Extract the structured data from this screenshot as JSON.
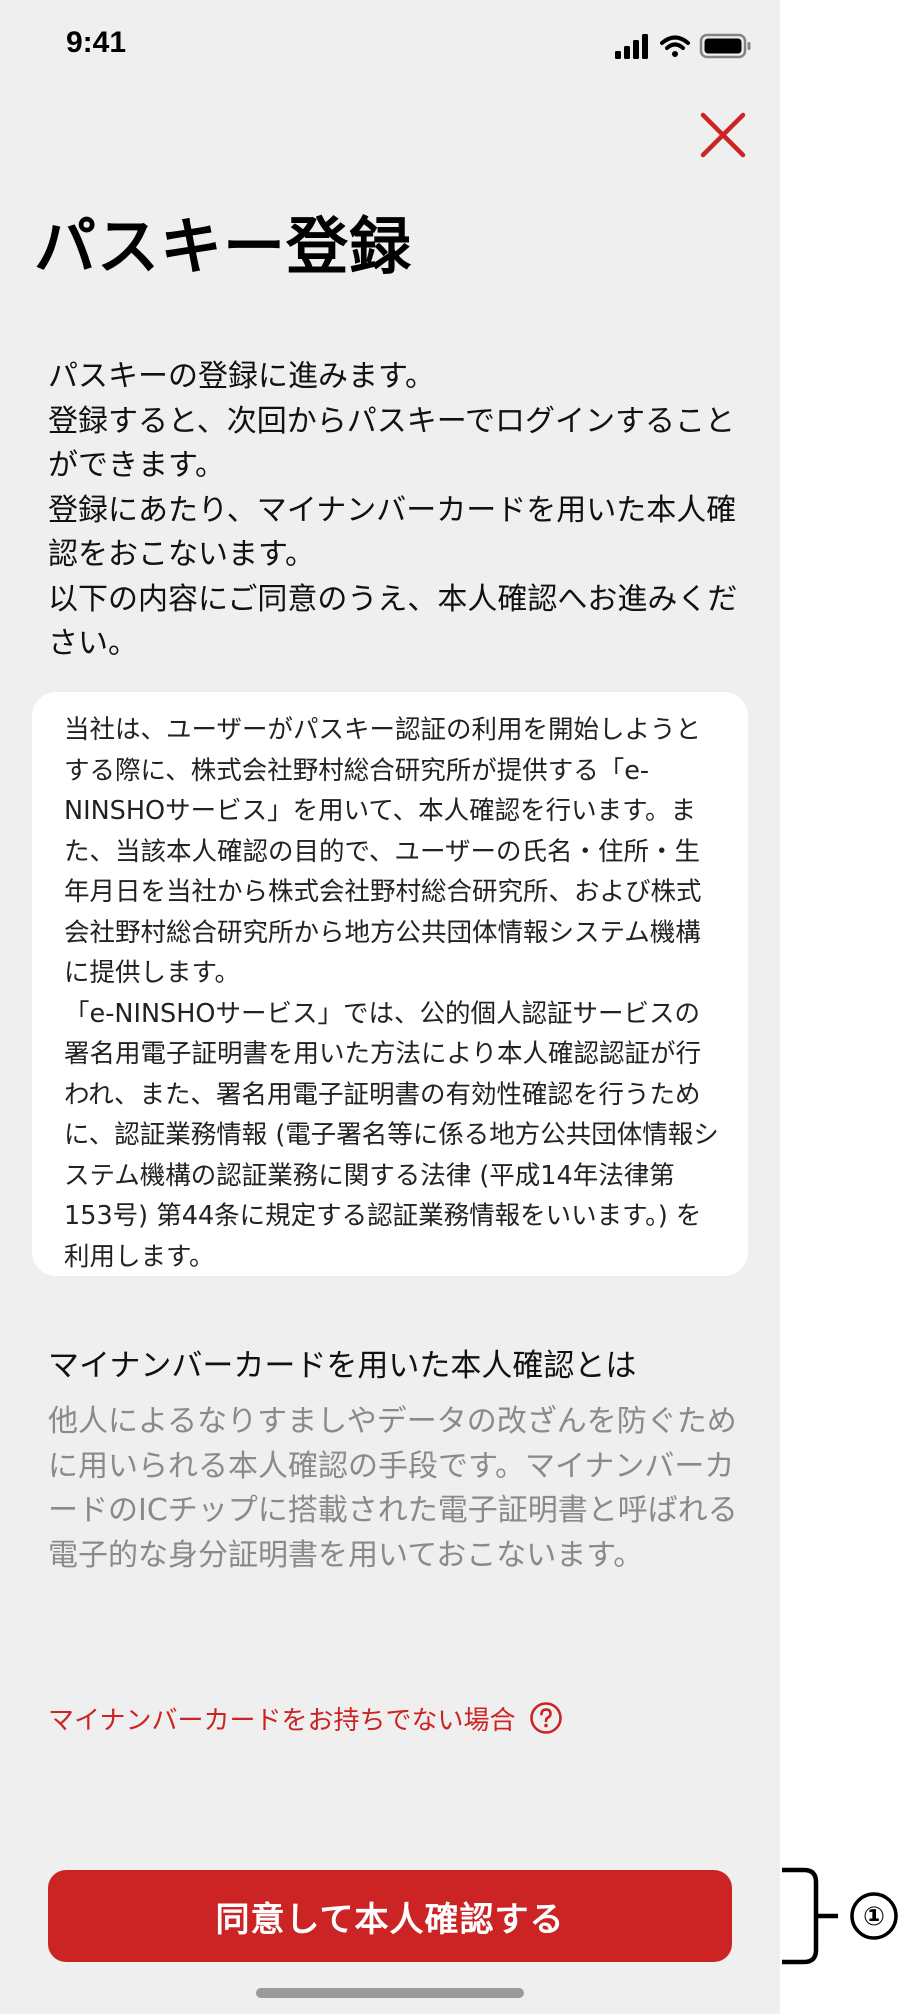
{
  "status_bar": {
    "time": "9:41",
    "icons": [
      "cellular-signal-icon",
      "wifi-icon",
      "battery-icon"
    ]
  },
  "header": {
    "close_icon": "close-icon",
    "title": "パスキー登録"
  },
  "intro": {
    "lines": [
      "パスキーの登録に進みます。",
      "登録すると、次回からパスキーでログインすることができます。",
      "登録にあたり、マイナンバーカードを用いた本人確認をおこないます。",
      "以下の内容にご同意のうえ、本人確認へお進みください。"
    ]
  },
  "terms": {
    "paragraphs": [
      "当社は、ユーザーがパスキー認証の利用を開始しようとする際に、株式会社野村総合研究所が提供する「e-NINSHOサービス」を用いて、本人確認を行います。また、当該本人確認の目的で、ユーザーの氏名・住所・生年月日を当社から株式会社野村総合研究所、および株式会社野村総合研究所から地方公共団体情報システム機構に提供します。",
      "「e-NINSHOサービス」では、公的個人認証サービスの署名用電子証明書を用いた方法により本人確認認証が行われ、また、署名用電子証明書の有効性確認を行うために、認証業務情報 (電子署名等に係る地方公共団体情報システム機構の認証業務に関する法律 (平成14年法律第153号) 第44条に規定する認証業務情報をいいます。) を利用します。"
    ]
  },
  "about": {
    "heading": "マイナンバーカードを用いた本人確認とは",
    "body": "他人によるなりすましやデータの改ざんを防ぐために用いられる本人確認の手段です。マイナンバーカードのICチップに搭載された電子証明書と呼ばれる電子的な身分証明書を用いておこないます。"
  },
  "no_card_link": {
    "label": "マイナンバーカードをお持ちでない場合",
    "icon": "help-circle-icon"
  },
  "primary_button": {
    "label": "同意して本人確認する"
  },
  "annotation": {
    "marker": "①"
  },
  "colors": {
    "accent": "#cc2424",
    "background": "#efefef",
    "card": "#ffffff",
    "muted_text": "#8a8a8a"
  }
}
